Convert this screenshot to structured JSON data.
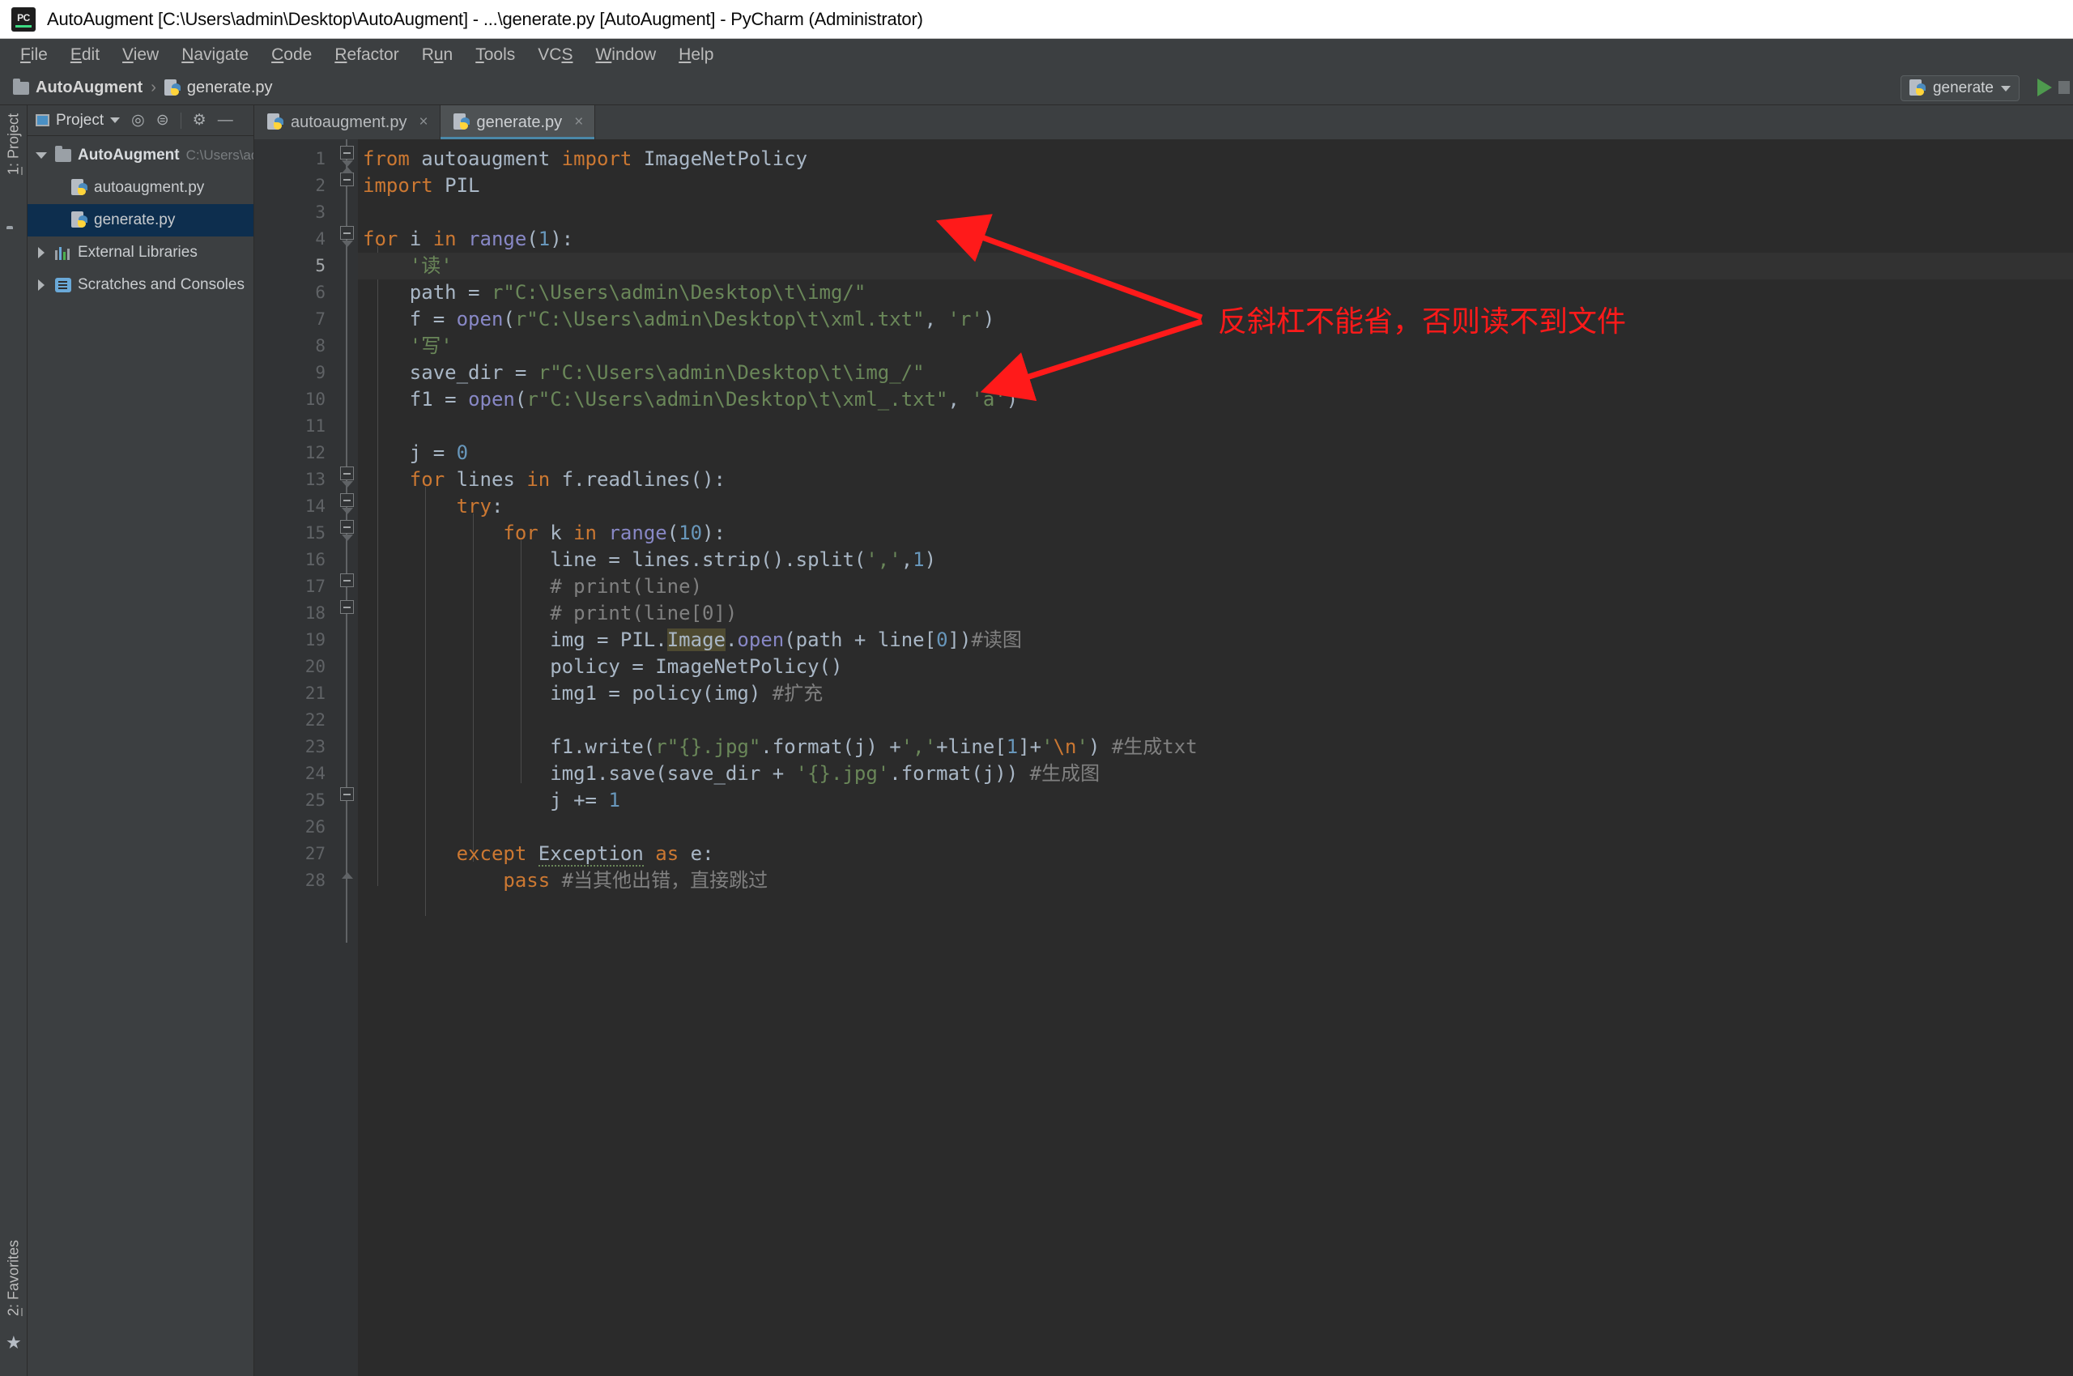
{
  "window": {
    "title": "AutoAugment [C:\\Users\\admin\\Desktop\\AutoAugment] - ...\\generate.py [AutoAugment] - PyCharm (Administrator)",
    "logo_text": "PC"
  },
  "menubar": {
    "items": [
      {
        "label": "File",
        "accel": "F"
      },
      {
        "label": "Edit",
        "accel": "E"
      },
      {
        "label": "View",
        "accel": "V"
      },
      {
        "label": "Navigate",
        "accel": "N"
      },
      {
        "label": "Code",
        "accel": "C"
      },
      {
        "label": "Refactor",
        "accel": "R"
      },
      {
        "label": "Run",
        "accel": "u"
      },
      {
        "label": "Tools",
        "accel": "T"
      },
      {
        "label": "VCS",
        "accel": "S"
      },
      {
        "label": "Window",
        "accel": "W"
      },
      {
        "label": "Help",
        "accel": "H"
      }
    ]
  },
  "navbar": {
    "crumb_project": "AutoAugment",
    "crumb_separator": "›",
    "crumb_file": "generate.py",
    "run_config": "generate"
  },
  "left_strip": {
    "project_label": "1: Project",
    "favorites_label": "2: Favorites"
  },
  "project_panel": {
    "title": "Project",
    "tree": [
      {
        "label": "AutoAugment",
        "sub": "C:\\Users\\adm",
        "level": 0,
        "kind": "folder",
        "expanded": true,
        "selected": false
      },
      {
        "label": "autoaugment.py",
        "sub": "",
        "level": 1,
        "kind": "python",
        "expanded": false,
        "selected": false
      },
      {
        "label": "generate.py",
        "sub": "",
        "level": 1,
        "kind": "python",
        "expanded": false,
        "selected": true
      },
      {
        "label": "External Libraries",
        "sub": "",
        "level": 0,
        "kind": "library",
        "expanded": false,
        "selected": false
      },
      {
        "label": "Scratches and Consoles",
        "sub": "",
        "level": 0,
        "kind": "scratch",
        "expanded": false,
        "selected": false
      }
    ]
  },
  "tabs": [
    {
      "label": "autoaugment.py",
      "active": false,
      "close": "×"
    },
    {
      "label": "generate.py",
      "active": true,
      "close": "×"
    }
  ],
  "editor": {
    "current_line": 5,
    "line_numbers": [
      1,
      2,
      3,
      4,
      5,
      6,
      7,
      8,
      9,
      10,
      11,
      12,
      13,
      14,
      15,
      16,
      17,
      18,
      19,
      20,
      21,
      22,
      23,
      24,
      25,
      26,
      27,
      28
    ],
    "code": [
      {
        "n": 1,
        "text": "from autoaugment import ImageNetPolicy"
      },
      {
        "n": 2,
        "text": "import PIL"
      },
      {
        "n": 3,
        "text": ""
      },
      {
        "n": 4,
        "text": "for i in range(1):"
      },
      {
        "n": 5,
        "text": "    '读'"
      },
      {
        "n": 6,
        "text": "    path = r\"C:\\Users\\admin\\Desktop\\t\\img/\""
      },
      {
        "n": 7,
        "text": "    f = open(r\"C:\\Users\\admin\\Desktop\\t\\xml.txt\", 'r')"
      },
      {
        "n": 8,
        "text": "    '写'"
      },
      {
        "n": 9,
        "text": "    save_dir = r\"C:\\Users\\admin\\Desktop\\t\\img_/\""
      },
      {
        "n": 10,
        "text": "    f1 = open(r\"C:\\Users\\admin\\Desktop\\t\\xml_.txt\", 'a')"
      },
      {
        "n": 11,
        "text": ""
      },
      {
        "n": 12,
        "text": "    j = 0"
      },
      {
        "n": 13,
        "text": "    for lines in f.readlines():"
      },
      {
        "n": 14,
        "text": "        try:"
      },
      {
        "n": 15,
        "text": "            for k in range(10):"
      },
      {
        "n": 16,
        "text": "                line = lines.strip().split(',',1)"
      },
      {
        "n": 17,
        "text": "                # print(line)"
      },
      {
        "n": 18,
        "text": "                # print(line[0])"
      },
      {
        "n": 19,
        "text": "                img = PIL.Image.open(path + line[0])#读图"
      },
      {
        "n": 20,
        "text": "                policy = ImageNetPolicy()"
      },
      {
        "n": 21,
        "text": "                img1 = policy(img) #扩充"
      },
      {
        "n": 22,
        "text": ""
      },
      {
        "n": 23,
        "text": "                f1.write(r\"{}.jpg\".format(j) +','+line[1]+'\\n') #生成txt"
      },
      {
        "n": 24,
        "text": "                img1.save(save_dir + '{}.jpg'.format(j)) #生成图"
      },
      {
        "n": 25,
        "text": "                j += 1"
      },
      {
        "n": 26,
        "text": ""
      },
      {
        "n": 27,
        "text": "        except Exception as e:"
      },
      {
        "n": 28,
        "text": "            pass #当其他出错，直接跳过"
      }
    ]
  },
  "annotation": {
    "text": "反斜杠不能省，否则读不到文件",
    "color": "#ff1a1a"
  },
  "colors": {
    "editor_bg": "#2b2b2b",
    "gutter_bg": "#313335",
    "panel_bg": "#3c3f41",
    "selection_bg": "#0d2e4e",
    "tab_active_bg": "#4e5254",
    "tab_underline": "#4a88a8",
    "keyword": "#cc7832",
    "string": "#6a8759",
    "number": "#6897bb",
    "function": "#8888c6",
    "comment": "#808080",
    "identifier": "#a9b7c6",
    "highlight_ident": "#4e4a31",
    "run_green": "#4e9a4e"
  }
}
